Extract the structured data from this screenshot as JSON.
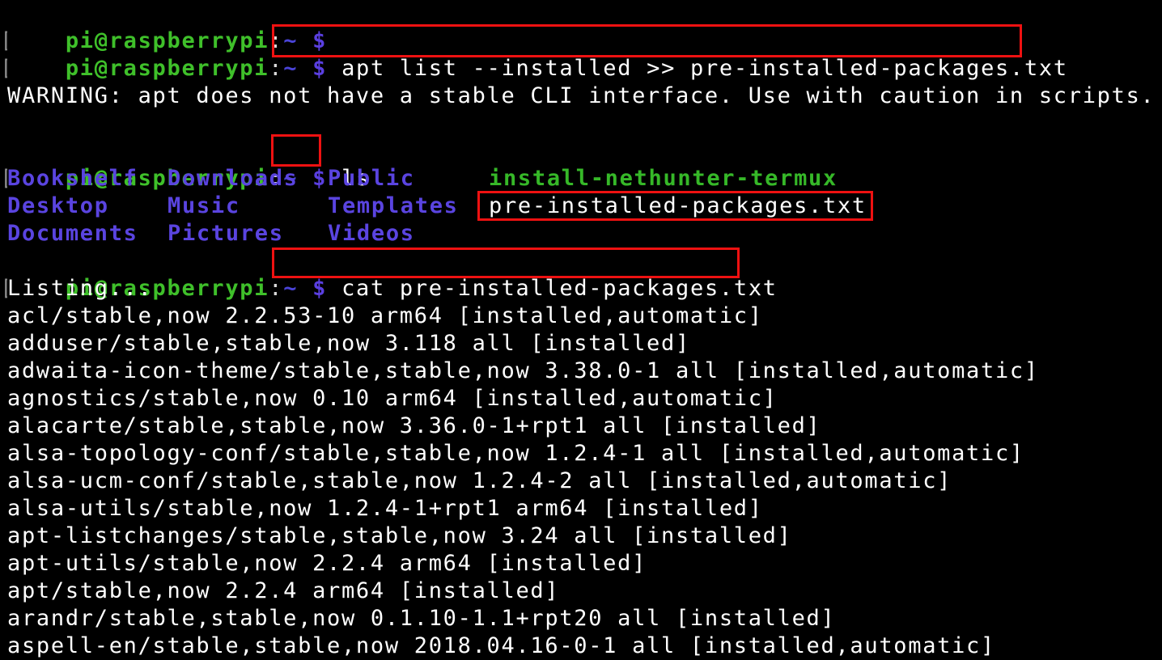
{
  "prompt": {
    "user_host": "pi@raspberrypi",
    "colon": ":",
    "cwd": "~",
    "symbol": "$"
  },
  "commands": {
    "c1": "",
    "c2": "apt list --installed >> pre-installed-packages.txt",
    "c3": "ls",
    "c4": "cat pre-installed-packages.txt"
  },
  "warning": "WARNING: apt does not have a stable CLI interface. Use with caution in scripts.",
  "ls_output": {
    "col1": [
      "Bookshelf",
      "Desktop",
      "Documents"
    ],
    "col2": [
      "Downloads",
      "Music",
      "Pictures"
    ],
    "col3": [
      "Public",
      "Templates",
      "Videos"
    ],
    "col4": [
      "install-nethunter-termux",
      "pre-installed-packages.txt"
    ]
  },
  "listing_header": "Listing...",
  "packages": [
    "acl/stable,now 2.2.53-10 arm64 [installed,automatic]",
    "adduser/stable,stable,now 3.118 all [installed]",
    "adwaita-icon-theme/stable,stable,now 3.38.0-1 all [installed,automatic]",
    "agnostics/stable,now 0.10 arm64 [installed,automatic]",
    "alacarte/stable,stable,now 3.36.0-1+rpt1 all [installed]",
    "alsa-topology-conf/stable,stable,now 1.2.4-1 all [installed,automatic]",
    "alsa-ucm-conf/stable,stable,now 1.2.4-2 all [installed,automatic]",
    "alsa-utils/stable,now 1.2.4-1+rpt1 arm64 [installed]",
    "apt-listchanges/stable,stable,now 3.24 all [installed]",
    "apt-utils/stable,now 2.2.4 arm64 [installed]",
    "apt/stable,now 2.2.4 arm64 [installed]",
    "arandr/stable,stable,now 0.1.10-1.1+rpt20 all [installed]",
    "aspell-en/stable,stable,now 2018.04.16-0-1 all [installed,automatic]"
  ],
  "colors": {
    "background": "#000000",
    "prompt_user": "#3fc02a",
    "prompt_symbol": "#5a3fe0",
    "directory": "#5a44e0",
    "executable": "#36b828",
    "text": "#ffffff",
    "highlight_box": "#ee1111"
  }
}
